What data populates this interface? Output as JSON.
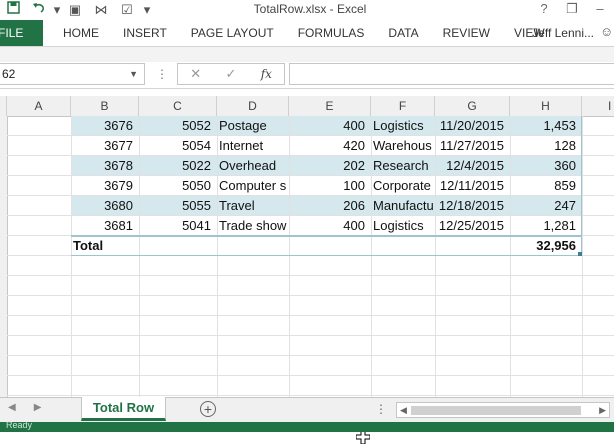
{
  "window": {
    "title": "TotalRow.xlsx - Excel",
    "help": "?",
    "restore": "❐",
    "minimize": "–"
  },
  "qat": {
    "save_icon": "save-icon",
    "undo_icon": "undo-icon",
    "undo_dd": "▾",
    "other1": "▣",
    "other2": "⋈",
    "other3": "☑",
    "customize": "▾"
  },
  "ribbon": {
    "file": "FILE",
    "tabs": [
      "HOME",
      "INSERT",
      "PAGE LAYOUT",
      "FORMULAS",
      "DATA",
      "REVIEW",
      "VIEW"
    ],
    "user": "Jeff Lenni...",
    "accent": "#217346"
  },
  "formula_bar": {
    "name_box": "62",
    "cancel": "✕",
    "enter": "✓",
    "fx": "fx",
    "content": ""
  },
  "columns": [
    "A",
    "B",
    "C",
    "D",
    "E",
    "F",
    "G",
    "H",
    "I"
  ],
  "table": {
    "band_color": "#d4e8ed",
    "rows": [
      {
        "b": "3676",
        "c": "5052",
        "d": "Postage",
        "e": "400",
        "f": "Logistics",
        "g": "11/20/2015",
        "h": "1,453",
        "banded": true
      },
      {
        "b": "3677",
        "c": "5054",
        "d": "Internet",
        "e": "420",
        "f": "Warehous",
        "g": "11/27/2015",
        "h": "128",
        "banded": false
      },
      {
        "b": "3678",
        "c": "5022",
        "d": "Overhead",
        "e": "202",
        "f": "Research",
        "g": "12/4/2015",
        "h": "360",
        "banded": true
      },
      {
        "b": "3679",
        "c": "5050",
        "d": "Computer s",
        "e": "100",
        "f": "Corporate",
        "g": "12/11/2015",
        "h": "859",
        "banded": false
      },
      {
        "b": "3680",
        "c": "5055",
        "d": "Travel",
        "e": "206",
        "f": "Manufactu",
        "g": "12/18/2015",
        "h": "247",
        "banded": true
      },
      {
        "b": "3681",
        "c": "5041",
        "d": "Trade show",
        "e": "400",
        "f": "Logistics",
        "g": "12/25/2015",
        "h": "1,281",
        "banded": false
      }
    ],
    "total": {
      "label": "Total",
      "value": "32,956"
    }
  },
  "sheets": {
    "active": "Total Row",
    "add": "+"
  },
  "statusbar": {
    "text": "Ready"
  }
}
